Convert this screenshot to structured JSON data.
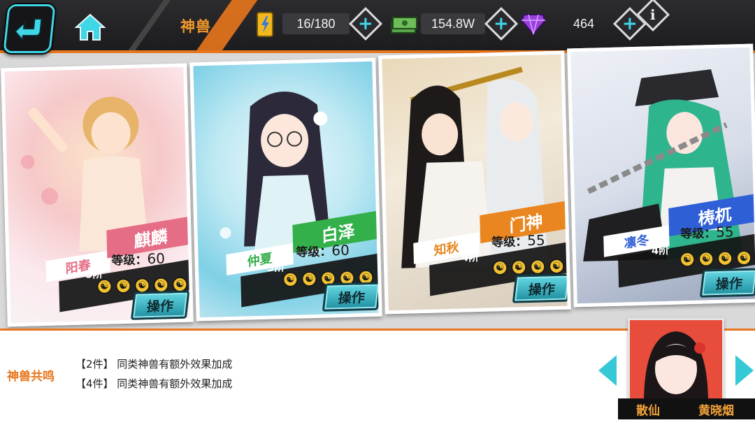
{
  "header": {
    "title": "神兽",
    "energy": "16/180",
    "money": "154.8W",
    "gems": "464"
  },
  "cards": [
    {
      "name": "阳春",
      "beast": "麒麟",
      "rank": "5阶",
      "level_label": "等级：",
      "level": "60",
      "accent": "#e56d86",
      "button": "操作"
    },
    {
      "name": "仲夏",
      "beast": "白泽",
      "rank": "5阶",
      "level_label": "等级：",
      "level": "60",
      "accent": "#34b04a",
      "button": "操作"
    },
    {
      "name": "知秋",
      "beast": "门神",
      "rank": "4阶",
      "level_label": "等级：",
      "level": "55",
      "accent": "#ea8620",
      "button": "操作"
    },
    {
      "name": "凛冬",
      "beast": "梼杌",
      "rank": "4阶",
      "level_label": "等级：",
      "level": "55",
      "accent": "#2f5fd6",
      "button": "操作"
    }
  ],
  "resonance": {
    "title": "神兽共鸣",
    "sets": [
      "【2件】 同类神兽有额外效果加成",
      "【4件】 同类神兽有额外效果加成"
    ]
  },
  "character": {
    "title": "散仙",
    "name": "黄晓烟"
  }
}
